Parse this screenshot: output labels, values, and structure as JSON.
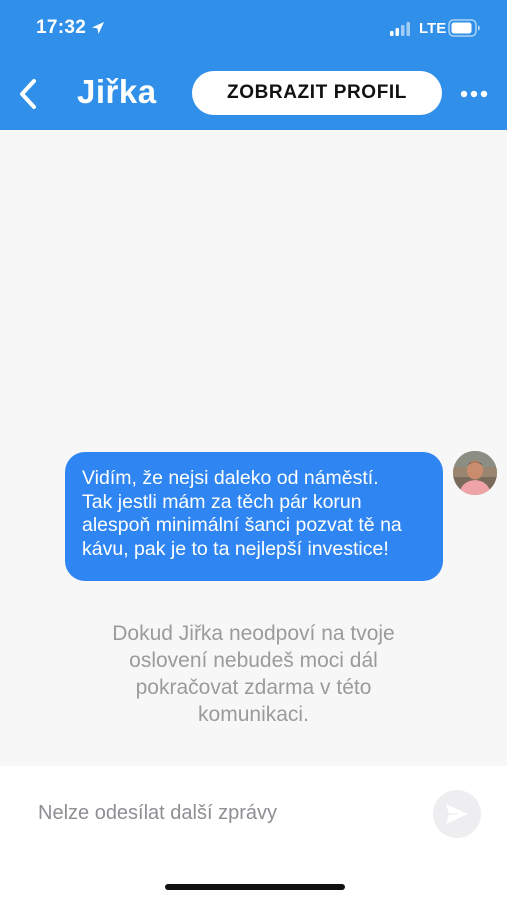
{
  "status_bar": {
    "time": "17:32",
    "network": "LTE"
  },
  "header": {
    "title": "Jiřka",
    "profile_button_label": "ZOBRAZIT PROFIL",
    "background_color": "#2f8fe9"
  },
  "messages": [
    {
      "direction": "outgoing",
      "lines": [
        "Vidím, že nejsi daleko od náměstí.",
        "Tak jestli mám za těch pár korun",
        "alespoň minimální šanci pozvat tě na",
        "kávu, pak je to ta nejlepší investice!"
      ],
      "bubble_color": "#2f86f2"
    }
  ],
  "notice": {
    "lines": [
      "Dokud Jiřka neodpoví na tvoje",
      "oslovení nebudeš moci dál",
      "pokračovat zdarma v této",
      "komunikaci."
    ]
  },
  "composer": {
    "placeholder": "Nelze odesílat další zprávy"
  },
  "icons": {
    "back": "chevron-left-icon",
    "more": "more-horizontal-icon",
    "send": "send-icon",
    "location": "location-arrow-icon",
    "signal": "signal-icon",
    "battery": "battery-icon"
  }
}
